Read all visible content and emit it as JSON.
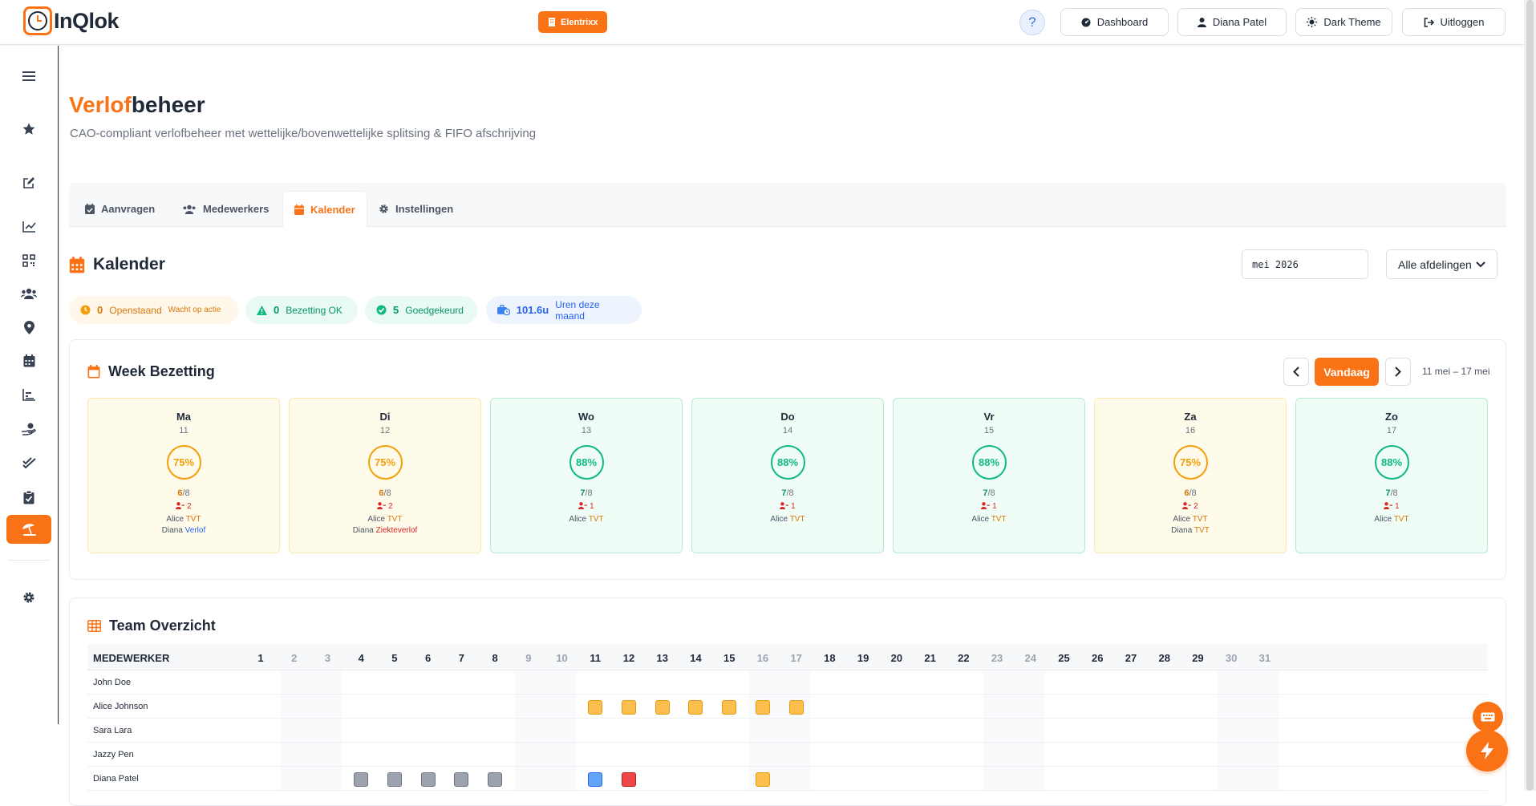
{
  "app": {
    "logo_text": "InQlok",
    "company": "Elentrixx"
  },
  "header": {
    "help": "?",
    "buttons": [
      {
        "label": "Dashboard",
        "icon": "gauge-icon"
      },
      {
        "label": "Diana Patel",
        "icon": "user-icon"
      },
      {
        "label": "Dark Theme",
        "icon": "sun-icon"
      },
      {
        "label": "Uitloggen",
        "icon": "logout-icon"
      }
    ]
  },
  "sidebar": {
    "items": [
      "menu-icon",
      "star-icon",
      "edit-icon",
      "chart-line-icon",
      "qrcode-icon",
      "users-icon",
      "location-icon",
      "calendar-icon",
      "bar-chart-icon",
      "hand-money-icon",
      "check-double-icon",
      "clipboard-check-icon",
      "umbrella-beach-icon",
      "gear-icon"
    ],
    "active": "umbrella-beach-icon"
  },
  "page": {
    "title_accent": "Verlof",
    "title_rest": "beheer",
    "subtitle": "CAO-compliant verlofbeheer met wettelijke/bovenwettelijke splitsing & FIFO afschrijving"
  },
  "tabs": [
    {
      "label": "Aanvragen",
      "icon": "calendar-check-icon"
    },
    {
      "label": "Medewerkers",
      "icon": "users-icon"
    },
    {
      "label": "Kalender",
      "icon": "calendar-icon",
      "active": true
    },
    {
      "label": "Instellingen",
      "icon": "gear-icon"
    }
  ],
  "calendar": {
    "title": "Kalender",
    "month_value": "mei 2026",
    "department": "Alle afdelingen"
  },
  "stats": {
    "pending": {
      "value": "0",
      "label": "Openstaand",
      "note": "Wacht op actie"
    },
    "occupancy": {
      "value": "0",
      "label": "Bezetting OK"
    },
    "approved": {
      "value": "5",
      "label": "Goedgekeurd"
    },
    "hours": {
      "value": "101.6u",
      "label": "Uren deze maand"
    }
  },
  "week": {
    "title": "Week Bezetting",
    "today": "Vandaag",
    "range": "11 mei – 17 mei",
    "days": [
      {
        "name": "Ma",
        "num": "11",
        "pct": "75%",
        "present": "6",
        "total": "/8",
        "absent": "2",
        "status": "warn",
        "leaves": [
          {
            "who": "Alice",
            "type": "TVT",
            "kind": "tvt"
          },
          {
            "who": "Diana",
            "type": "Verlof",
            "kind": "verlof"
          }
        ]
      },
      {
        "name": "Di",
        "num": "12",
        "pct": "75%",
        "present": "6",
        "total": "/8",
        "absent": "2",
        "status": "warn",
        "leaves": [
          {
            "who": "Alice",
            "type": "TVT",
            "kind": "tvt"
          },
          {
            "who": "Diana",
            "type": "Ziekteverlof",
            "kind": "ziek"
          }
        ]
      },
      {
        "name": "Wo",
        "num": "13",
        "pct": "88%",
        "present": "7",
        "total": "/8",
        "absent": "1",
        "status": "ok",
        "leaves": [
          {
            "who": "Alice",
            "type": "TVT",
            "kind": "tvt"
          }
        ]
      },
      {
        "name": "Do",
        "num": "14",
        "pct": "88%",
        "present": "7",
        "total": "/8",
        "absent": "1",
        "status": "ok",
        "leaves": [
          {
            "who": "Alice",
            "type": "TVT",
            "kind": "tvt"
          }
        ]
      },
      {
        "name": "Vr",
        "num": "15",
        "pct": "88%",
        "present": "7",
        "total": "/8",
        "absent": "1",
        "status": "ok",
        "leaves": [
          {
            "who": "Alice",
            "type": "TVT",
            "kind": "tvt"
          }
        ]
      },
      {
        "name": "Za",
        "num": "16",
        "pct": "75%",
        "present": "6",
        "total": "/8",
        "absent": "2",
        "status": "warn",
        "leaves": [
          {
            "who": "Alice",
            "type": "TVT",
            "kind": "tvt"
          },
          {
            "who": "Diana",
            "type": "TVT",
            "kind": "tvt"
          }
        ]
      },
      {
        "name": "Zo",
        "num": "17",
        "pct": "88%",
        "present": "7",
        "total": "/8",
        "absent": "1",
        "status": "ok",
        "leaves": [
          {
            "who": "Alice",
            "type": "TVT",
            "kind": "tvt"
          }
        ]
      }
    ]
  },
  "team": {
    "title": "Team Overzicht",
    "header": "MEDEWERKER",
    "days": [
      "1",
      "2",
      "3",
      "4",
      "5",
      "6",
      "7",
      "8",
      "9",
      "10",
      "11",
      "12",
      "13",
      "14",
      "15",
      "16",
      "17",
      "18",
      "19",
      "20",
      "21",
      "22",
      "23",
      "24",
      "25",
      "26",
      "27",
      "28",
      "29",
      "30",
      "31"
    ],
    "weekend_days": [
      2,
      3,
      9,
      10,
      16,
      17,
      23,
      24,
      30,
      31
    ],
    "rows": [
      {
        "name": "John Doe",
        "cells": []
      },
      {
        "name": "Alice Johnson",
        "cells": [
          {
            "day": 11,
            "kind": "tvt"
          },
          {
            "day": 12,
            "kind": "tvt"
          },
          {
            "day": 13,
            "kind": "tvt"
          },
          {
            "day": 14,
            "kind": "tvt"
          },
          {
            "day": 15,
            "kind": "tvt"
          },
          {
            "day": 16,
            "kind": "tvt"
          },
          {
            "day": 17,
            "kind": "tvt"
          }
        ]
      },
      {
        "name": "Sara Lara",
        "cells": []
      },
      {
        "name": "Jazzy Pen",
        "cells": []
      },
      {
        "name": "Diana Patel",
        "cells": [
          {
            "day": 4,
            "kind": "gray"
          },
          {
            "day": 5,
            "kind": "gray"
          },
          {
            "day": 6,
            "kind": "gray"
          },
          {
            "day": 7,
            "kind": "gray"
          },
          {
            "day": 8,
            "kind": "gray"
          },
          {
            "day": 11,
            "kind": "blue"
          },
          {
            "day": 12,
            "kind": "red"
          },
          {
            "day": 16,
            "kind": "tvt"
          }
        ]
      }
    ]
  },
  "colors": {
    "accent": "#f97316",
    "ok": "#10b981",
    "warn": "#f59e0b",
    "danger": "#dc2626",
    "info": "#2563eb"
  }
}
